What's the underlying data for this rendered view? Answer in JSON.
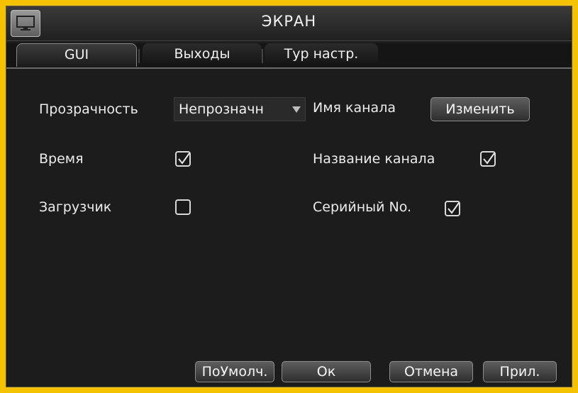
{
  "window": {
    "title": "ЭКРАН",
    "icon": "monitor-icon"
  },
  "tabs": [
    {
      "label": "GUI",
      "active": true
    },
    {
      "label": "Выходы",
      "active": false
    },
    {
      "label": "Тур настр.",
      "active": false
    }
  ],
  "settings": {
    "transparency_label": "Прозрачность",
    "transparency_value": "Непрозначн",
    "channel_name_label": "Имя канала",
    "channel_name_button": "Изменить",
    "time_label": "Время",
    "time_checked": true,
    "loader_label": "Загрузчик",
    "loader_checked": false,
    "channel_title_label": "Название канала",
    "channel_title_checked": true,
    "serial_label": "Серийный No.",
    "serial_checked": true
  },
  "footer": {
    "defaults_label": "ПоУмолч.",
    "ok_label": "Ок",
    "cancel_label": "Отмена",
    "apply_label": "Прил."
  },
  "colors": {
    "frame": "#f5c200",
    "background": "#1c1c1c",
    "text": "#ececec"
  }
}
